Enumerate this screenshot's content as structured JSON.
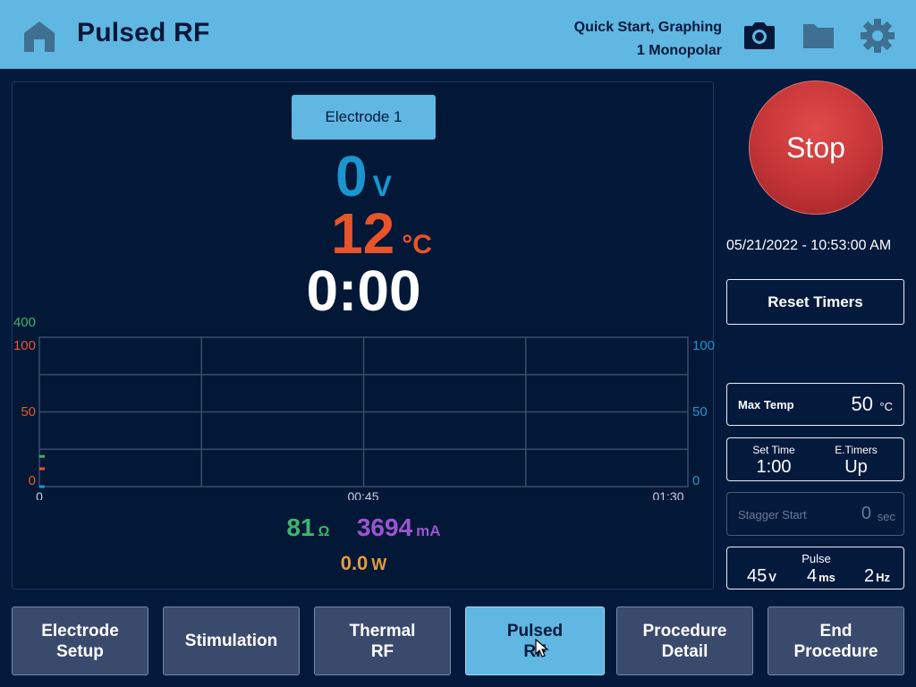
{
  "header": {
    "title": "Pulsed RF",
    "mode_line1": "Quick Start, Graphing",
    "mode_line2": "1 Monopolar",
    "icons": [
      "home-icon",
      "camera-icon",
      "folder-icon",
      "gear-icon"
    ]
  },
  "electrode": {
    "label": "Electrode 1"
  },
  "readout": {
    "voltage": "0",
    "voltage_unit": "V",
    "temperature": "12",
    "temperature_unit": "°C",
    "timer": "0:00"
  },
  "chart_data": {
    "type": "line",
    "left_axis_ticks": [
      "400",
      "100",
      "50",
      "0"
    ],
    "right_axis_ticks": [
      "100",
      "50",
      "0"
    ],
    "x_ticks": [
      "0",
      "00:45",
      "01:30"
    ],
    "series": [
      {
        "color": "#3fb370",
        "values": [
          81
        ]
      },
      {
        "color": "#e9542a",
        "values": [
          12
        ]
      },
      {
        "color": "#1a95d0",
        "values": [
          0
        ]
      }
    ]
  },
  "measurements": {
    "impedance": "81",
    "impedance_unit": "Ω",
    "current": "3694",
    "current_unit": "mA",
    "power": "0.0",
    "power_unit": "W"
  },
  "controls": {
    "stop_label": "Stop",
    "datetime": "05/21/2022 - 10:53:00 AM",
    "reset_label": "Reset Timers"
  },
  "settings": {
    "max_temp_label": "Max Temp",
    "max_temp_value": "50",
    "max_temp_unit": "°C",
    "set_time_label": "Set Time",
    "set_time_value": "1:00",
    "etimers_label": "E.Timers",
    "etimers_value": "Up",
    "stagger_label": "Stagger Start",
    "stagger_value": "0",
    "stagger_unit": "sec",
    "pulse_label": "Pulse",
    "pulse_voltage": "45",
    "pulse_voltage_unit": "V",
    "pulse_width": "4",
    "pulse_width_unit": "ms",
    "pulse_rate": "2",
    "pulse_rate_unit": "Hz"
  },
  "tabs": [
    {
      "label": "Electrode\nSetup"
    },
    {
      "label": "Stimulation"
    },
    {
      "label": "Thermal\nRF"
    },
    {
      "label": "Pulsed\nRF"
    },
    {
      "label": "Procedure\nDetail"
    },
    {
      "label": "End\nProcedure"
    }
  ],
  "active_tab": 3,
  "colors": {
    "header_bg": "#5fb7e2",
    "background": "#031a3d",
    "voltage": "#1a95d0",
    "temperature": "#e9542a",
    "impedance": "#3fb370",
    "current": "#9a55cf",
    "power": "#e79a3c",
    "stop": "#c43537"
  }
}
